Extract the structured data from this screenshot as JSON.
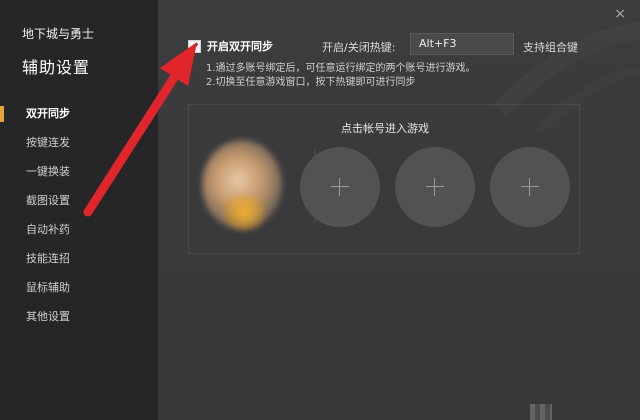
{
  "sidebar": {
    "app_title": "地下城与勇士",
    "section_title": "辅助设置",
    "items": [
      {
        "label": "双开同步",
        "active": true
      },
      {
        "label": "按键连发"
      },
      {
        "label": "一键换装"
      },
      {
        "label": "截图设置"
      },
      {
        "label": "自动补药"
      },
      {
        "label": "技能连招"
      },
      {
        "label": "鼠标辅助"
      },
      {
        "label": "其他设置"
      }
    ]
  },
  "window": {
    "close_label": "×"
  },
  "sync": {
    "checkbox_label": "开启双开同步",
    "checked": true,
    "hotkey_label": "开启/关闭热键:",
    "hotkey_value": "Alt+F3",
    "combo_label": "支持组合键",
    "tip1": "1.通过多账号绑定后，可任意运行绑定的两个账号进行游戏。",
    "tip2": "2.切换至任意游戏窗口，按下热键即可进行同步"
  },
  "accounts": {
    "title": "点击帐号进入游戏",
    "empty_slot_count": 3
  },
  "colors": {
    "accent": "#e8a43a",
    "arrow": "#e0262a",
    "sidebar_bg": "#262628",
    "content_bg": "#3a3a3c"
  }
}
